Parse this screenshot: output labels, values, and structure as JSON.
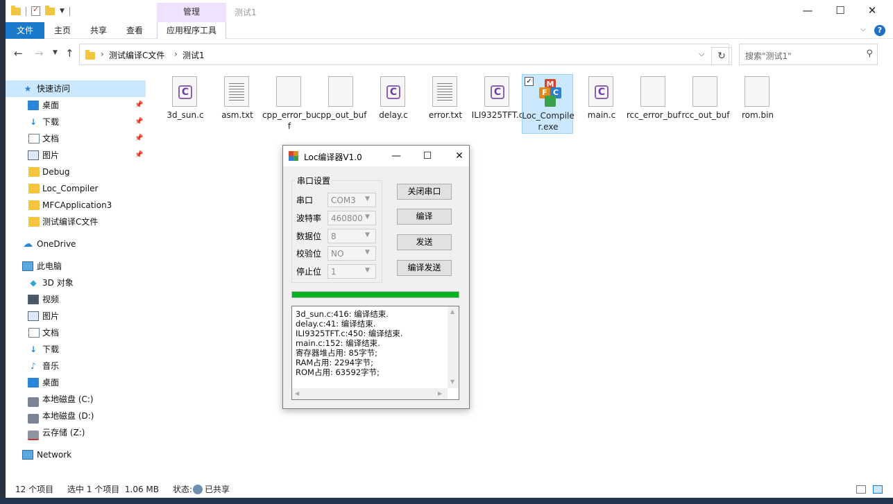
{
  "title_bar": {
    "context_group": "管理",
    "window_title": "测试1",
    "minimize": "—",
    "maximize": "☐",
    "close": "✕"
  },
  "ribbon": {
    "tabs": [
      "文件",
      "主页",
      "共享",
      "查看",
      "应用程序工具"
    ],
    "help": "?"
  },
  "address": {
    "breadcrumbs": [
      "测试编译C文件",
      "测试1"
    ],
    "search_placeholder": "搜索\"测试1\""
  },
  "sidebar": {
    "items": [
      {
        "label": "快速访问",
        "icon": "star-icon"
      },
      {
        "label": "桌面",
        "icon": "desktop-icon",
        "pinned": true
      },
      {
        "label": "下载",
        "icon": "download-icon",
        "pinned": true
      },
      {
        "label": "文档",
        "icon": "document-icon",
        "pinned": true
      },
      {
        "label": "图片",
        "icon": "pictures-icon",
        "pinned": true
      },
      {
        "label": "Debug",
        "icon": "folder-icon"
      },
      {
        "label": "Loc_Compiler",
        "icon": "folder-icon"
      },
      {
        "label": "MFCApplication3",
        "icon": "folder-icon"
      },
      {
        "label": "测试编译C文件",
        "icon": "folder-icon"
      },
      {
        "label": "OneDrive",
        "icon": "cloud-icon"
      },
      {
        "label": "此电脑",
        "icon": "pc-icon"
      },
      {
        "label": "3D 对象",
        "icon": "cube-icon"
      },
      {
        "label": "视频",
        "icon": "video-icon"
      },
      {
        "label": "图片",
        "icon": "pictures-icon"
      },
      {
        "label": "文档",
        "icon": "document-icon"
      },
      {
        "label": "下载",
        "icon": "download-icon"
      },
      {
        "label": "音乐",
        "icon": "music-icon"
      },
      {
        "label": "桌面",
        "icon": "desktop-icon"
      },
      {
        "label": "本地磁盘 (C:)",
        "icon": "drive-icon"
      },
      {
        "label": "本地磁盘 (D:)",
        "icon": "drive-icon"
      },
      {
        "label": "云存储 (Z:)",
        "icon": "network-drive-icon"
      },
      {
        "label": "Network",
        "icon": "network-icon"
      }
    ]
  },
  "files": [
    {
      "name": "3d_sun.c",
      "icon": "c-source-file-icon"
    },
    {
      "name": "asm.txt",
      "icon": "text-file-icon"
    },
    {
      "name": "cpp_error_buf",
      "icon": "blank-file-icon"
    },
    {
      "name": "cpp_out_buf",
      "icon": "blank-file-icon"
    },
    {
      "name": "delay.c",
      "icon": "c-source-file-icon"
    },
    {
      "name": "error.txt",
      "icon": "text-file-icon"
    },
    {
      "name": "ILI9325TFT.c",
      "icon": "c-source-file-icon"
    },
    {
      "name": "Loc_Compiler.exe",
      "icon": "mfc-app-icon",
      "selected": true
    },
    {
      "name": "main.c",
      "icon": "c-source-file-icon"
    },
    {
      "name": "rcc_error_buf",
      "icon": "blank-file-icon"
    },
    {
      "name": "rcc_out_buf",
      "icon": "blank-file-icon"
    },
    {
      "name": "rom.bin",
      "icon": "blank-file-icon"
    }
  ],
  "status_bar": {
    "count": "12 个项目",
    "selection": "选中 1 个项目  1.06 MB",
    "state": "状态:",
    "shared": "已共享"
  },
  "dialog": {
    "title": "Loc编译器V1.0",
    "min": "—",
    "max": "☐",
    "close": "✕",
    "group_label": "串口设置",
    "fields": [
      {
        "label": "串口",
        "value": "COM3"
      },
      {
        "label": "波特率",
        "value": "460800"
      },
      {
        "label": "数据位",
        "value": "8"
      },
      {
        "label": "校验位",
        "value": "NO"
      },
      {
        "label": "停止位",
        "value": "1"
      }
    ],
    "buttons": [
      "关闭串口",
      "编译",
      "发送",
      "编译发送"
    ],
    "progress": 1.0,
    "progress_color": "#06b025",
    "log": [
      "3d_sun.c:416: 编译结束.",
      "delay.c:41: 编译结束.",
      "ILI9325TFT.c:450: 编译结束.",
      "main.c:152: 编译结束.",
      "寄存器堆占用: 85字节;",
      "RAM占用: 2294字节;",
      "ROM占用: 63592字节;"
    ]
  },
  "colors": {
    "file_tab": "#1979ca",
    "context_tab": "#efe1ff",
    "selection": "#cce8ff",
    "c_file_badge": "#8a5fb4"
  }
}
